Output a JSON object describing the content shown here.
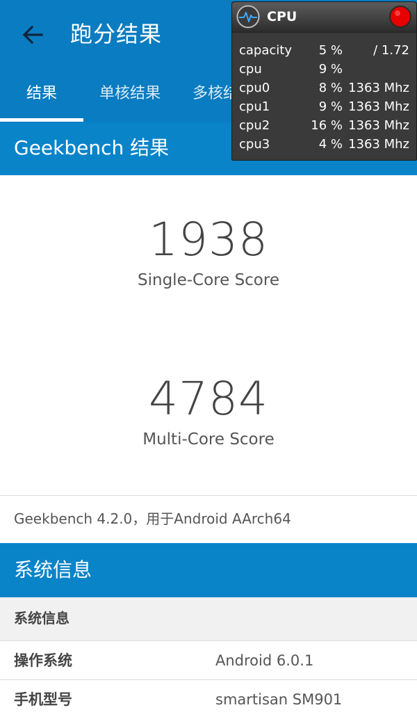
{
  "header": {
    "title": "跑分结果"
  },
  "tabs": [
    {
      "label": "结果"
    },
    {
      "label": "单核结果"
    },
    {
      "label": "多核结果"
    }
  ],
  "section": {
    "title": "Geekbench 结果"
  },
  "scores": {
    "single_value": "1938",
    "single_label": "Single-Core Score",
    "multi_value": "4784",
    "multi_label": "Multi-Core Score"
  },
  "version_line": "Geekbench 4.2.0，用于Android AArch64",
  "system_info": {
    "title": "系统信息",
    "subheader": "系统信息",
    "rows": [
      {
        "key": "操作系统",
        "value": "Android 6.0.1"
      },
      {
        "key": "手机型号",
        "value": "smartisan SM901"
      }
    ]
  },
  "cpu_widget": {
    "title": "CPU",
    "rows": [
      {
        "name": "capacity",
        "pct": "5 %",
        "freq": "/ 1.72"
      },
      {
        "name": "cpu",
        "pct": "9 %",
        "freq": ""
      },
      {
        "name": "cpu0",
        "pct": "8 %",
        "freq": "1363 Mhz"
      },
      {
        "name": "cpu1",
        "pct": "9 %",
        "freq": "1363 Mhz"
      },
      {
        "name": "cpu2",
        "pct": "16 %",
        "freq": "1363 Mhz"
      },
      {
        "name": "cpu3",
        "pct": "4 %",
        "freq": "1363 Mhz"
      }
    ]
  },
  "colors": {
    "primary": "#0a7cc1",
    "section": "#0a84c9",
    "subheader_bg": "#f1f1f1",
    "widget_bg": "#3a3a3a",
    "close_red": "#e60000"
  },
  "icons": {
    "back": "arrow-left-icon",
    "widget": "pulse-icon",
    "close": "red-close-icon"
  }
}
